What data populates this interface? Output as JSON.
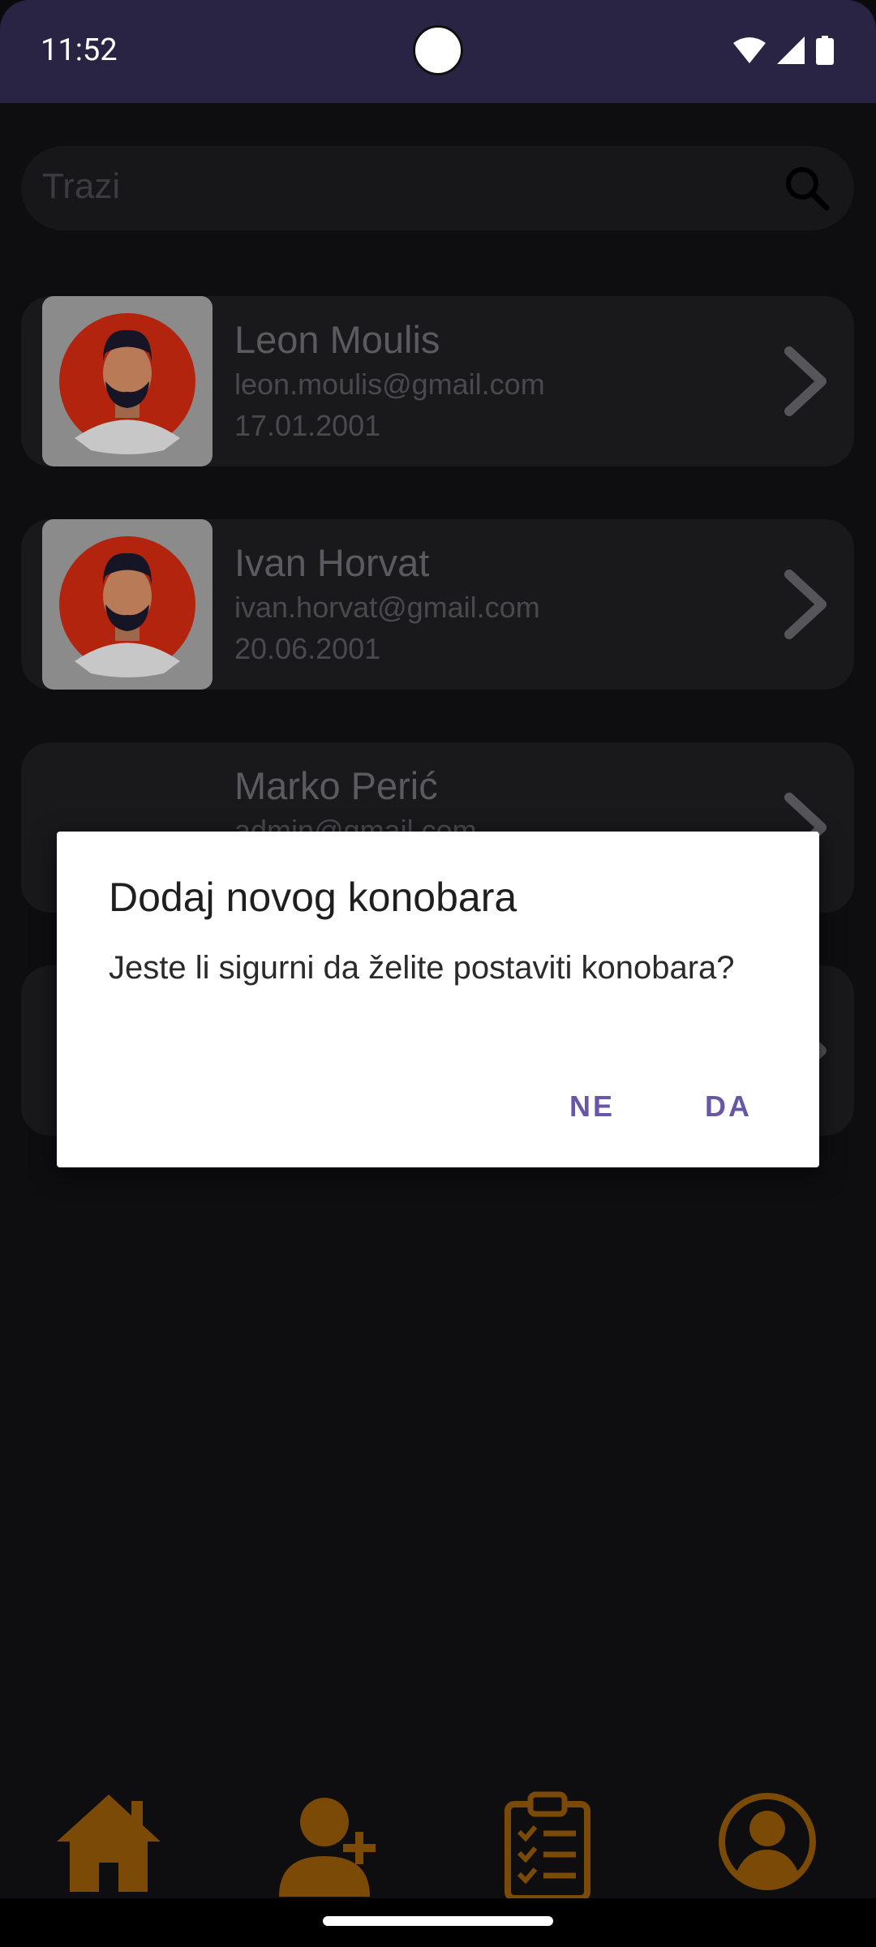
{
  "status_bar": {
    "time": "11:52"
  },
  "search": {
    "placeholder": "Trazi"
  },
  "waiters": [
    {
      "name": "Leon Moulis",
      "email": "leon.moulis@gmail.com",
      "date": "17.01.2001"
    },
    {
      "name": "Ivan Horvat",
      "email": "ivan.horvat@gmail.com",
      "date": "20.06.2001"
    },
    {
      "name": "Marko Perić",
      "email": "admin@gmail.com"
    }
  ],
  "dialog": {
    "title": "Dodaj novog konobara",
    "message": "Jeste li sigurni da želite postaviti konobara?",
    "negative_label": "NE",
    "positive_label": "DA"
  },
  "bottom_nav": {
    "items": [
      "home-icon",
      "add-user-icon",
      "clipboard-checklist-icon",
      "profile-icon"
    ]
  },
  "colors": {
    "accent": "#6a56a6",
    "nav_icon": "#7a4a06",
    "status_bar": "#2a2444"
  }
}
